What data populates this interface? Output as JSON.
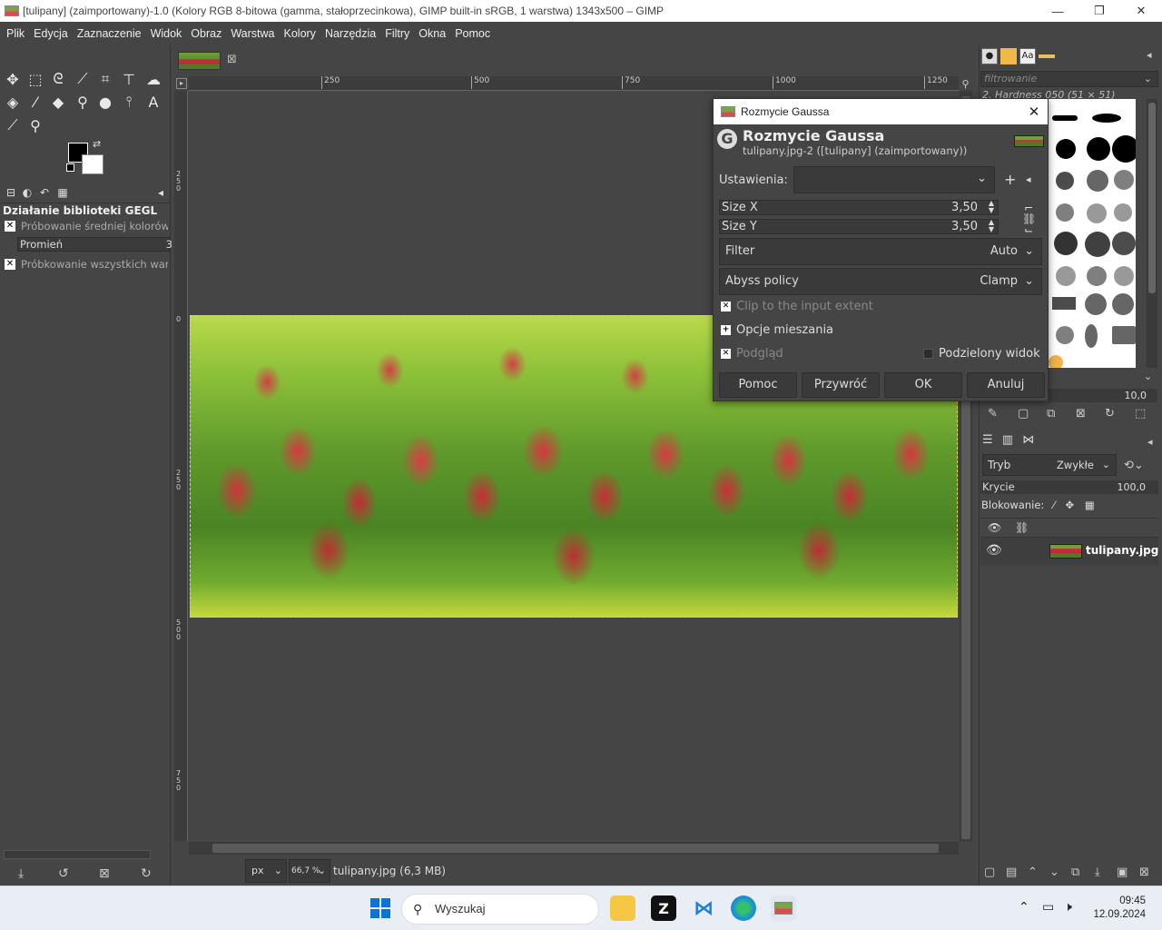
{
  "window": {
    "title": "[tulipany] (zaimportowany)-1.0 (Kolory RGB 8-bitowa (gamma, stałoprzecinkowa), GIMP built-in sRGB, 1 warstwa) 1343x500 – GIMP",
    "minimize": "—",
    "maximize": "❐",
    "close": "✕"
  },
  "menu": [
    "Plik",
    "Edycja",
    "Zaznaczenie",
    "Widok",
    "Obraz",
    "Warstwa",
    "Kolory",
    "Narzędzia",
    "Filtry",
    "Okna",
    "Pomoc"
  ],
  "tool_options": {
    "title": "Działanie biblioteki GEGL",
    "sample_average": "Próbowanie średniej kolorów",
    "radius_label": "Promień",
    "radius_value": "3",
    "sample_merged": "Próbkowanie wszystkich warstw"
  },
  "rulers": {
    "h_ticks": [
      "250",
      "500",
      "750",
      "1000",
      "1250"
    ],
    "v_ticks": [
      "250",
      "0",
      "250",
      "500",
      "750"
    ]
  },
  "status": {
    "unit": "px",
    "zoom": "66,7 %",
    "file_info": "tulipany.jpg (6,3 MB)"
  },
  "brushes": {
    "filter_placeholder": "filtrowanie",
    "current": "2. Hardness 050 (51 × 51)",
    "spacing": "10,0"
  },
  "layers": {
    "mode_label": "Tryb",
    "mode_value": "Zwykłe",
    "opacity_label": "Krycie",
    "opacity_value": "100,0",
    "lock_label": "Blokowanie:",
    "layer_name": "tulipany.jpg"
  },
  "dialog": {
    "window_title": "Rozmycie Gaussa",
    "heading": "Rozmycie Gaussa",
    "subheading": "tulipany.jpg-2 ([tulipany] (zaimportowany))",
    "presets_label": "Ustawienia:",
    "size_x_label": "Size X",
    "size_x_value": "3,50",
    "size_y_label": "Size Y",
    "size_y_value": "3,50",
    "filter_label": "Filter",
    "filter_value": "Auto",
    "abyss_label": "Abyss policy",
    "abyss_value": "Clamp",
    "clip_label": "Clip to the input extent",
    "blend_label": "Opcje mieszania",
    "preview_label": "Podgląd",
    "split_label": "Podzielony widok",
    "help": "Pomoc",
    "reset": "Przywróć",
    "ok": "OK",
    "cancel": "Anuluj"
  },
  "taskbar": {
    "search_placeholder": "Wyszukaj",
    "time": "09:45",
    "date": "12.09.2024"
  }
}
